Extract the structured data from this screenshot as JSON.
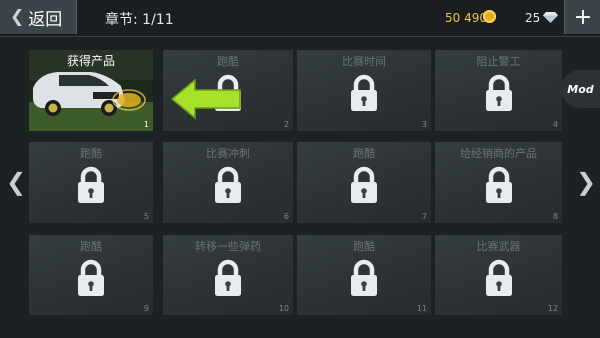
{
  "header": {
    "back_label": "返回",
    "chapter": "章节: 1/11",
    "coins": "50 490",
    "gems": "25",
    "plus_label": "+"
  },
  "mod_label": "Mod",
  "icons": [
    "back-chevron-icon",
    "coin-icon",
    "diamond-icon",
    "plus-icon",
    "lock-icon",
    "green-arrow-icon",
    "nav-left-icon",
    "nav-right-icon"
  ],
  "colors": {
    "coin": "#f2c542",
    "arrow": "#a6e22a"
  },
  "levels": [
    {
      "title": "获得产品",
      "num": "1",
      "locked": false
    },
    {
      "title": "跑酷",
      "num": "2",
      "locked": true
    },
    {
      "title": "比赛时间",
      "num": "3",
      "locked": true
    },
    {
      "title": "阻止警工",
      "num": "4",
      "locked": true
    },
    {
      "title": "跑酷",
      "num": "5",
      "locked": true
    },
    {
      "title": "比赛冲刺",
      "num": "6",
      "locked": true
    },
    {
      "title": "跑酷",
      "num": "7",
      "locked": true
    },
    {
      "title": "给经销商的产品",
      "num": "8",
      "locked": true
    },
    {
      "title": "跑酷",
      "num": "9",
      "locked": true
    },
    {
      "title": "转移一些弹药",
      "num": "10",
      "locked": true
    },
    {
      "title": "跑酷",
      "num": "11",
      "locked": true
    },
    {
      "title": "比赛武器",
      "num": "12",
      "locked": true
    }
  ]
}
